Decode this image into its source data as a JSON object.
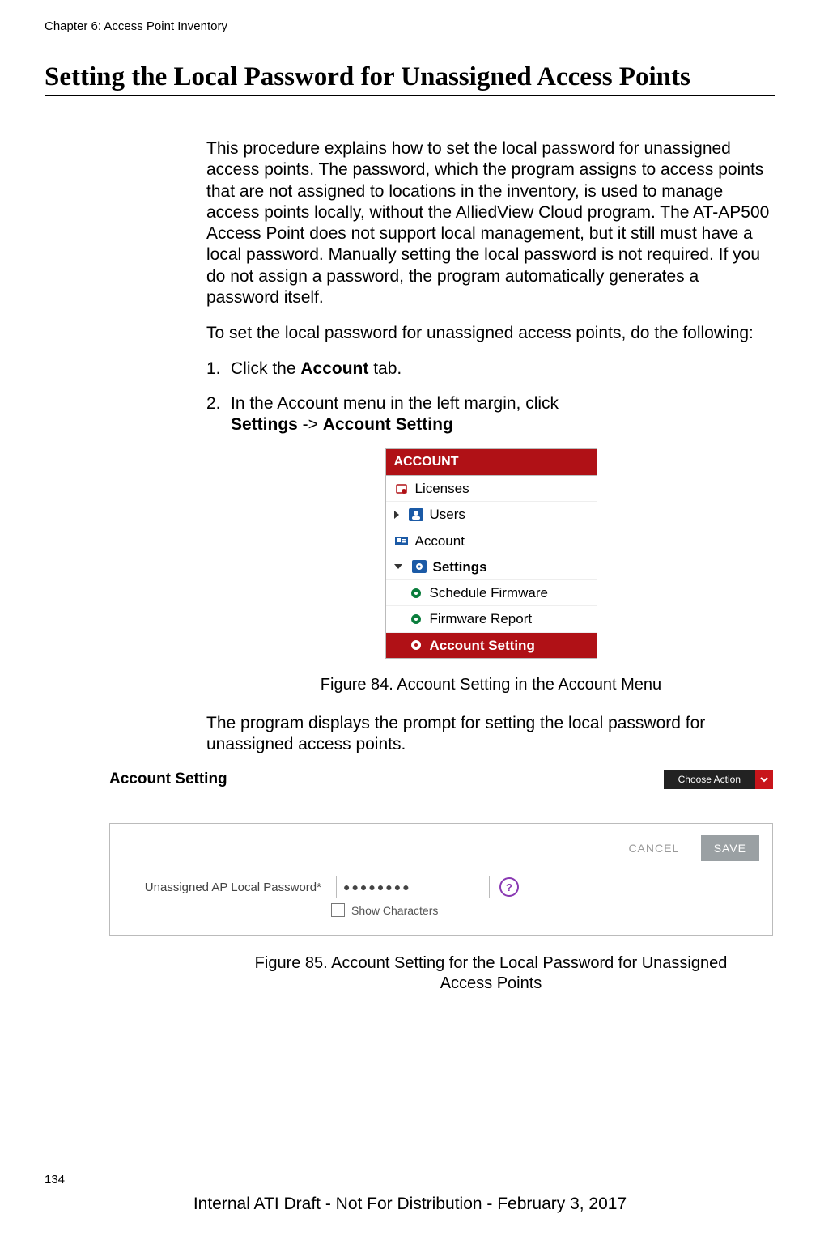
{
  "header": {
    "chapter": "Chapter 6: Access Point Inventory"
  },
  "title": "Setting the Local Password for Unassigned Access Points",
  "intro": "This procedure explains how to set the local password for unassigned access points. The password, which the program assigns to access points that are not assigned to locations in the inventory, is used to manage access points locally, without the AlliedView Cloud program. The AT-AP500 Access Point does not support local management, but it still must have a local password. Manually setting the local password is not required. If you do not assign a password, the program automatically generates a password itself.",
  "lead_in": "To set the local password for unassigned access points, do the following:",
  "steps": [
    {
      "num": "1.",
      "pre": "Click the ",
      "bold1": "Account",
      "post": " tab."
    },
    {
      "num": "2.",
      "line1_pre": "In the Account menu in the left margin, click",
      "line2_bold1": "Settings",
      "line2_mid": " -> ",
      "line2_bold2": "Account Setting"
    }
  ],
  "menu": {
    "header": "ACCOUNT",
    "items": {
      "licenses": "Licenses",
      "users": "Users",
      "account": "Account",
      "settings": "Settings",
      "schedule_firmware": "Schedule Firmware",
      "firmware_report": "Firmware Report",
      "account_setting": "Account Setting"
    }
  },
  "figure84_caption": "Figure 84. Account Setting in the Account Menu",
  "after_fig84": "The program displays the prompt for setting the local password for unassigned access points.",
  "panel": {
    "title": "Account Setting",
    "choose_action": "Choose Action",
    "cancel": "CANCEL",
    "save": "SAVE",
    "label": "Unassigned AP Local Password*",
    "value_mask": "●●●●●●●●",
    "show_characters": "Show Characters",
    "help": "?"
  },
  "figure85_caption": "Figure 85. Account Setting for the Local Password for Unassigned Access Points",
  "page_number": "134",
  "footer": "Internal ATI Draft - Not For Distribution - February 3, 2017"
}
